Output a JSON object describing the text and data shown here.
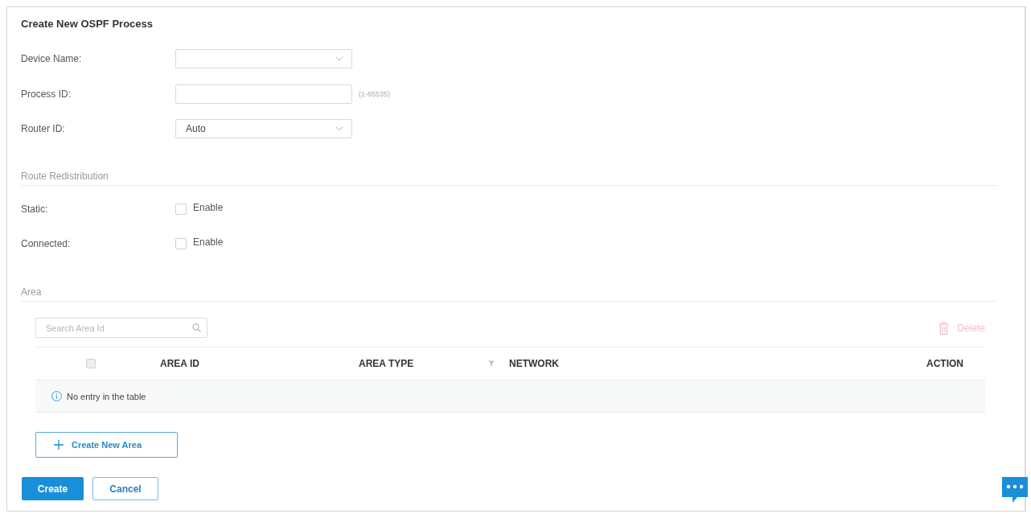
{
  "title": "Create New OSPF Process",
  "fields": [
    {
      "kind": "select",
      "label": "Device Name:"
    },
    {
      "kind": "input",
      "label": "Process ID:",
      "hint": "(1-65535)"
    },
    {
      "kind": "select",
      "label": "Router ID:",
      "value": "Auto"
    }
  ],
  "route_redistribution": {
    "heading": "Route Redistribution",
    "options": [
      {
        "label": "Static:",
        "text": "Enable",
        "checked": false
      },
      {
        "label": "Connected:",
        "text": "Enable",
        "checked": false
      }
    ]
  },
  "area": {
    "heading": "Area",
    "search": {
      "placeholder": "Search Area Id"
    },
    "delete_button": {
      "label": "Delete",
      "disabled": true
    },
    "table": {
      "select_all": {
        "checked": false,
        "disabled": true
      },
      "columns": [
        {
          "label": "AREA ID",
          "filter": false
        },
        {
          "label": "AREA TYPE",
          "filter": true
        },
        {
          "label": "NETWORK",
          "filter": false
        },
        {
          "label": "ACTION",
          "filter": false
        }
      ],
      "empty_message": "No entry in the table"
    },
    "create_button": "Create New Area"
  },
  "buttons": [
    {
      "kind": "primary",
      "label": "Create"
    },
    {
      "kind": "secondary",
      "label": "Cancel"
    }
  ]
}
